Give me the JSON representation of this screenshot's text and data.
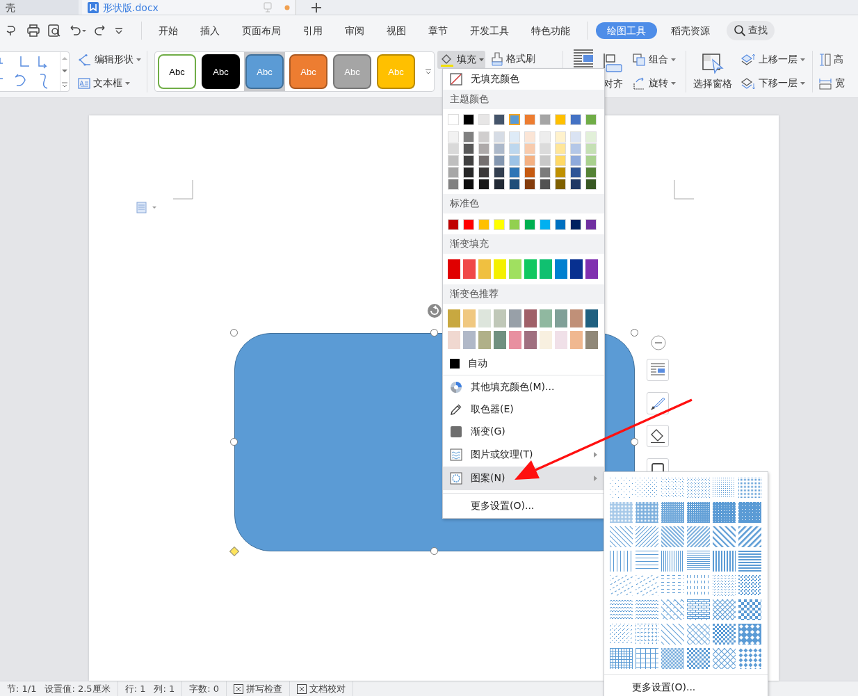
{
  "tabs": [
    {
      "label": "壳",
      "selected": false
    },
    {
      "label": "形状版.docx",
      "selected": true
    }
  ],
  "menu_tabs": [
    {
      "label": "开始",
      "selected": false
    },
    {
      "label": "插入",
      "selected": false
    },
    {
      "label": "页面布局",
      "selected": false
    },
    {
      "label": "引用",
      "selected": false
    },
    {
      "label": "审阅",
      "selected": false
    },
    {
      "label": "视图",
      "selected": false
    },
    {
      "label": "章节",
      "selected": false
    },
    {
      "label": "开发工具",
      "selected": false
    },
    {
      "label": "特色功能",
      "selected": false
    },
    {
      "label": "绘图工具",
      "selected": true
    },
    {
      "label": "稻壳资源",
      "selected": false
    }
  ],
  "search": "查找",
  "ribbon": {
    "edit_shape": "编辑形状",
    "text_box": "文本框",
    "styles": [
      {
        "label": "Abc",
        "color": "#ffffff",
        "selected": false
      },
      {
        "label": "Abc",
        "color": "#000000",
        "selected": false
      },
      {
        "label": "Abc",
        "color": "#5b9bd5",
        "selected": true
      },
      {
        "label": "Abc",
        "color": "#ed7d31",
        "selected": false
      },
      {
        "label": "Abc",
        "color": "#a5a5a5",
        "selected": false
      },
      {
        "label": "Abc",
        "color": "#ffc000",
        "selected": false
      }
    ],
    "fill": {
      "label": "填充",
      "expanded": true
    },
    "format_painter": "格式刷",
    "align": "对齐",
    "group": "组合",
    "rotate": "旋转",
    "selection_pane": "选择窗格",
    "bring_forward": "上移一层",
    "send_backward": "下移一层",
    "height": "高",
    "width": "宽"
  },
  "fill_menu": {
    "no_fill": "无填充颜色",
    "theme_heading": "主题颜色",
    "theme_colors": [
      {
        "color": "#ffffff",
        "selected": false
      },
      {
        "color": "#000000",
        "selected": false
      },
      {
        "color": "#e7e6e6",
        "selected": false
      },
      {
        "color": "#44546a",
        "selected": false
      },
      {
        "color": "#5b9bd5",
        "selected": true
      },
      {
        "color": "#ed7d31",
        "selected": false
      },
      {
        "color": "#a5a5a5",
        "selected": false
      },
      {
        "color": "#ffc000",
        "selected": false
      },
      {
        "color": "#4472c4",
        "selected": false
      },
      {
        "color": "#70ad47",
        "selected": false
      }
    ],
    "shade_rows": [
      [
        {
          "color": "#f2f2f2"
        },
        {
          "color": "#808080"
        },
        {
          "color": "#d0cece"
        },
        {
          "color": "#d6dce5"
        },
        {
          "color": "#deebf7"
        },
        {
          "color": "#fbe5d6"
        },
        {
          "color": "#ededed"
        },
        {
          "color": "#fff2cc"
        },
        {
          "color": "#dae3f3"
        },
        {
          "color": "#e2f0d9"
        }
      ],
      [
        {
          "color": "#d9d9d9"
        },
        {
          "color": "#595959"
        },
        {
          "color": "#aeaaaa"
        },
        {
          "color": "#adb9ca"
        },
        {
          "color": "#bdd7ee"
        },
        {
          "color": "#f8cbad"
        },
        {
          "color": "#dbdbdb"
        },
        {
          "color": "#ffe699"
        },
        {
          "color": "#b4c7e7"
        },
        {
          "color": "#c5e0b4"
        }
      ],
      [
        {
          "color": "#bfbfbf"
        },
        {
          "color": "#404040"
        },
        {
          "color": "#757070"
        },
        {
          "color": "#8497b0"
        },
        {
          "color": "#9dc3e6"
        },
        {
          "color": "#f4b183"
        },
        {
          "color": "#c9c9c9"
        },
        {
          "color": "#ffd966"
        },
        {
          "color": "#8faadc"
        },
        {
          "color": "#a9d18e"
        }
      ],
      [
        {
          "color": "#a6a6a6"
        },
        {
          "color": "#262626"
        },
        {
          "color": "#3a3838"
        },
        {
          "color": "#333f50"
        },
        {
          "color": "#2e75b6"
        },
        {
          "color": "#c55a11"
        },
        {
          "color": "#7b7b7b"
        },
        {
          "color": "#bf9000"
        },
        {
          "color": "#2f5597"
        },
        {
          "color": "#548235"
        }
      ],
      [
        {
          "color": "#808080"
        },
        {
          "color": "#0d0d0d"
        },
        {
          "color": "#171717"
        },
        {
          "color": "#222a35"
        },
        {
          "color": "#1f4e79"
        },
        {
          "color": "#843c0c"
        },
        {
          "color": "#525252"
        },
        {
          "color": "#7f6000"
        },
        {
          "color": "#203864"
        },
        {
          "color": "#385723"
        }
      ]
    ],
    "standard_heading": "标准色",
    "standard_colors": [
      {
        "color": "#c00000"
      },
      {
        "color": "#ff0000"
      },
      {
        "color": "#ffc000"
      },
      {
        "color": "#ffff00"
      },
      {
        "color": "#92d050"
      },
      {
        "color": "#00b050"
      },
      {
        "color": "#00b0f0"
      },
      {
        "color": "#0070c0"
      },
      {
        "color": "#002060"
      },
      {
        "color": "#7030a0"
      }
    ],
    "gradient_heading": "渐变填充",
    "gradients": [
      {
        "color": "#e00000"
      },
      {
        "color": "#f04848"
      },
      {
        "color": "#f0c040"
      },
      {
        "color": "#f4f000"
      },
      {
        "color": "#a0e060"
      },
      {
        "color": "#10c860"
      },
      {
        "color": "#10c070"
      },
      {
        "color": "#0080d0"
      },
      {
        "color": "#083090"
      },
      {
        "color": "#8030b0"
      }
    ],
    "recommended_heading": "渐变色推荐",
    "recommended": [
      [
        {
          "color": "#c8a840"
        },
        {
          "color": "#f0c880"
        },
        {
          "color": "#dde5dc"
        },
        {
          "color": "#c0c8b8"
        },
        {
          "color": "#98a0a8"
        },
        {
          "color": "#a06068"
        },
        {
          "color": "#90b8a0"
        },
        {
          "color": "#80a098"
        },
        {
          "color": "#c09078"
        },
        {
          "color": "#206080"
        }
      ],
      [
        {
          "color": "#f0d8d0"
        },
        {
          "color": "#b0b8c8"
        },
        {
          "color": "#b0b088"
        },
        {
          "color": "#709080"
        },
        {
          "color": "#e890a0"
        },
        {
          "color": "#a07080"
        },
        {
          "color": "#f8f0e0"
        },
        {
          "color": "#f0e0e8"
        },
        {
          "color": "#f0b890"
        },
        {
          "color": "#908878"
        }
      ]
    ],
    "auto": "自动",
    "items": [
      {
        "label": "其他填充颜色(M)...",
        "kind": "more-colors",
        "submenu": false,
        "selected": false
      },
      {
        "label": "取色器(E)",
        "kind": "eyedropper",
        "submenu": false,
        "selected": false
      },
      {
        "label": "渐变(G)",
        "kind": "gradient",
        "submenu": false,
        "selected": false
      },
      {
        "label": "图片或纹理(T)",
        "kind": "texture",
        "submenu": true,
        "selected": false
      },
      {
        "label": "图案(N)",
        "kind": "pattern",
        "submenu": true,
        "selected": true
      }
    ],
    "more": "更多设置(O)..."
  },
  "pattern_menu": {
    "more": "更多设置(O)..."
  },
  "status_bar": [
    {
      "label": "节: 1/1",
      "kind": "text"
    },
    {
      "label": "设置值: 2.5厘米",
      "kind": "text"
    },
    {
      "label": "行: 1",
      "kind": "text"
    },
    {
      "label": "列: 1",
      "kind": "text"
    },
    {
      "label": "字数: 0",
      "kind": "text"
    },
    {
      "label": "拼写检查",
      "kind": "toggle"
    },
    {
      "label": "文档校对",
      "kind": "toggle"
    }
  ]
}
